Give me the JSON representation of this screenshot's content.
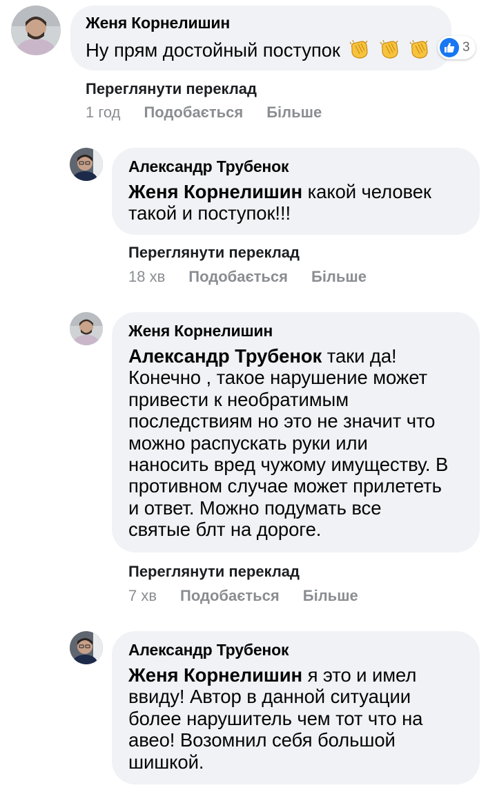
{
  "comments": [
    {
      "author": "Женя Корнелишин",
      "text": "Ну прям достойный поступок",
      "emojis": [
        "clapping-hands",
        "clapping-hands",
        "clapping-hands"
      ],
      "reaction_count": "3",
      "translate_label": "Переглянути переклад",
      "time": "1 год",
      "like_label": "Подобається",
      "more_label": "Більше"
    },
    {
      "author": "Александр Трубенок",
      "mention": "Женя Корнелишин",
      "line1": "какой человек",
      "line2": "такой и поступок!!!",
      "translate_label": "Переглянути переклад",
      "time": "18 хв",
      "like_label": "Подобається",
      "more_label": "Більше"
    },
    {
      "author": "Женя Корнелишин",
      "mention": "Александр Трубенок",
      "line1": "таки да!",
      "lines": [
        "Конечно , такое нарушение может",
        "привести к необратимым",
        "последствиям но это не значит что",
        "можно распускать руки или",
        "наносить вред чужому имуществу. В",
        "противном случае может прилететь",
        "и ответ. Можно подумать все",
        "святые блт на дороге."
      ],
      "translate_label": "Переглянути переклад",
      "time": "7 хв",
      "like_label": "Подобається",
      "more_label": "Більше"
    },
    {
      "author": "Александр Трубенок",
      "mention": "Женя Корнелишин",
      "line1": "я это и имел",
      "lines": [
        "ввиду! Автор в данной ситуации",
        "более нарушитель чем тот что на",
        "авео! Возомнил себя большой",
        "шишкой."
      ]
    }
  ],
  "colors": {
    "bubble": "#f0f2f5",
    "like_blue": "#1877f2",
    "meta_gray": "#8a8d91",
    "emoji_yellow": "#f7c33d"
  }
}
